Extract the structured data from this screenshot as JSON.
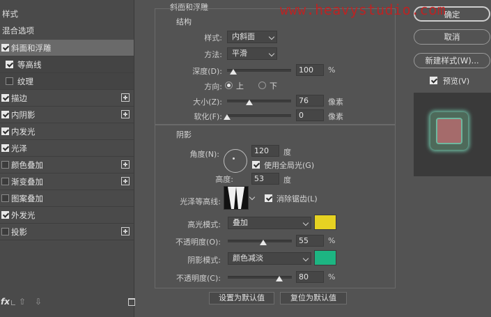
{
  "watermark": "www.heavystudio.com",
  "left_panel": {
    "header": "样式",
    "blending": "混合选项",
    "items": [
      {
        "label": "斜面和浮雕",
        "checked": true,
        "plus": false,
        "selected": true,
        "sub": false
      },
      {
        "label": "等高线",
        "checked": true,
        "plus": false,
        "selected": false,
        "sub": true
      },
      {
        "label": "纹理",
        "checked": false,
        "plus": false,
        "selected": false,
        "sub": true
      },
      {
        "label": "描边",
        "checked": true,
        "plus": true,
        "selected": false,
        "sub": false
      },
      {
        "label": "内阴影",
        "checked": true,
        "plus": true,
        "selected": false,
        "sub": false
      },
      {
        "label": "内发光",
        "checked": true,
        "plus": false,
        "selected": false,
        "sub": false
      },
      {
        "label": "光泽",
        "checked": true,
        "plus": false,
        "selected": false,
        "sub": false
      },
      {
        "label": "颜色叠加",
        "checked": false,
        "plus": true,
        "selected": false,
        "sub": false
      },
      {
        "label": "渐变叠加",
        "checked": false,
        "plus": true,
        "selected": false,
        "sub": false
      },
      {
        "label": "图案叠加",
        "checked": false,
        "plus": false,
        "selected": false,
        "sub": false
      },
      {
        "label": "外发光",
        "checked": true,
        "plus": false,
        "selected": false,
        "sub": false
      },
      {
        "label": "投影",
        "checked": false,
        "plus": true,
        "selected": false,
        "sub": false
      }
    ],
    "footer": {
      "fx": "fx"
    }
  },
  "bevel": {
    "title": "斜面和浮雕",
    "structure_title": "结构",
    "style_label": "样式:",
    "style_value": "内斜面",
    "method_label": "方法:",
    "method_value": "平滑",
    "depth_label": "深度(D):",
    "depth_value": "100",
    "depth_unit": "%",
    "direction_label": "方向:",
    "dir_up": "上",
    "dir_down": "下",
    "direction_selected": "上",
    "size_label": "大小(Z):",
    "size_value": "76",
    "size_unit": "像素",
    "soften_label": "软化(F):",
    "soften_value": "0",
    "soften_unit": "像素"
  },
  "shading": {
    "title": "阴影",
    "angle_label": "角度(N):",
    "angle_value": "120",
    "angle_unit": "度",
    "global_light_label": "使用全局光(G)",
    "global_light_checked": true,
    "altitude_label": "高度:",
    "altitude_value": "53",
    "altitude_unit": "度",
    "gloss_contour_label": "光泽等高线:",
    "anti_alias_label": "消除锯齿(L)",
    "anti_alias_checked": true,
    "highlight_mode_label": "高光模式:",
    "highlight_mode_value": "叠加",
    "highlight_color": "#e6d222",
    "highlight_opacity_label": "不透明度(O):",
    "highlight_opacity_value": "55",
    "highlight_opacity_unit": "%",
    "shadow_mode_label": "阴影模式:",
    "shadow_mode_value": "颜色减淡",
    "shadow_color": "#1db582",
    "shadow_opacity_label": "不透明度(C):",
    "shadow_opacity_value": "80",
    "shadow_opacity_unit": "%"
  },
  "bottom_buttons": {
    "set_default": "设置为默认值",
    "reset_default": "复位为默认值"
  },
  "right_panel": {
    "ok": "确定",
    "cancel": "取消",
    "new_style": "新建样式(W)...",
    "preview_label": "预览(V)",
    "preview_checked": true
  },
  "sliders": {
    "depth": 0.1,
    "size": 0.35,
    "soften": 0.0,
    "highlight_opacity": 0.55,
    "shadow_opacity": 0.8
  }
}
